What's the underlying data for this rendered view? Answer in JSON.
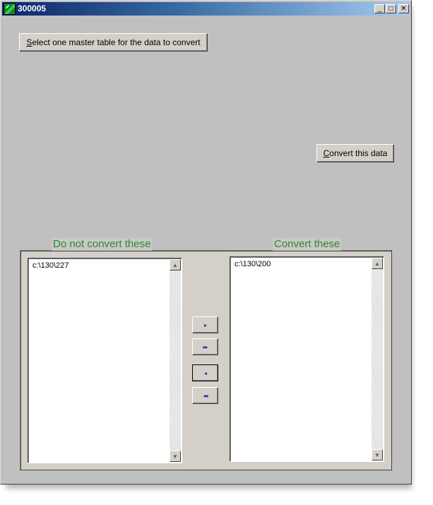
{
  "window": {
    "title": "300005",
    "icon": "app-icon",
    "controls": {
      "minimize": "_",
      "maximize": "□",
      "close": "✕"
    }
  },
  "buttons": {
    "select_master_mnemonic": "S",
    "select_master_rest": "elect one master table for the data to convert",
    "convert_mnemonic": "C",
    "convert_rest": "onvert this data",
    "move_right": "▸",
    "move_all_right": "▸▸",
    "move_left": "◂",
    "move_all_left": "◂◂"
  },
  "left_list": {
    "caption": "Do not convert these",
    "items": [
      "c:\\130\\227"
    ]
  },
  "right_list": {
    "caption": "Convert these",
    "items": [
      "c:\\130\\200"
    ]
  },
  "scrollbar": {
    "up": "▲",
    "down": "▼"
  },
  "colors": {
    "caption_green": "#2d8a2d",
    "arrow_blue": "#1a2aa0",
    "titlebar_start": "#0a246a"
  }
}
